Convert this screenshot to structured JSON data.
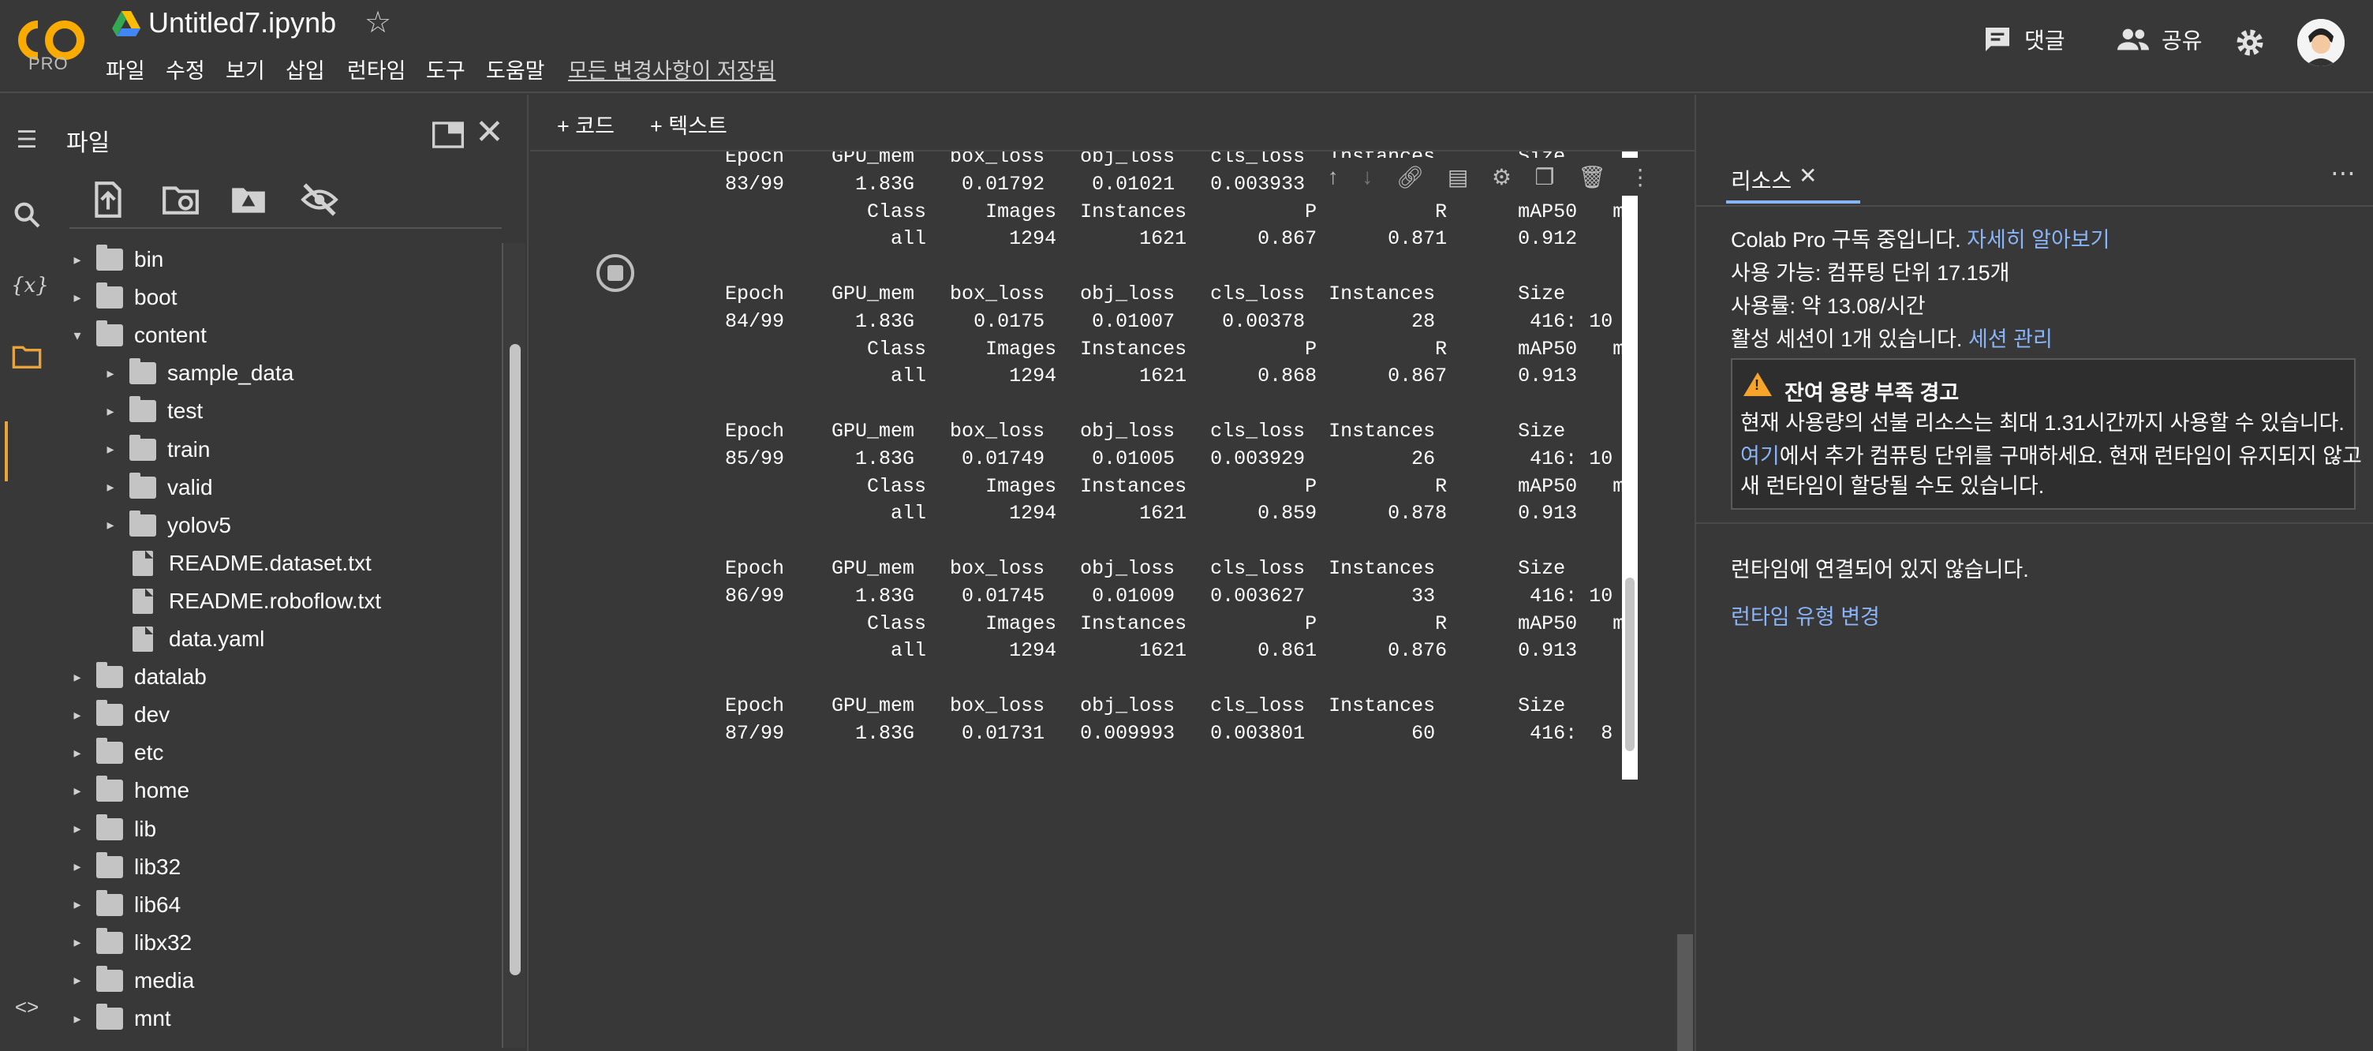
{
  "app": {
    "logo_text": "CO",
    "logo_tier": "PRO",
    "notebook_title": "Untitled7.ipynb",
    "menu": [
      "파일",
      "수정",
      "보기",
      "삽입",
      "런타임",
      "도구",
      "도움말"
    ],
    "saved_status": "모든 변경사항이 저장됨",
    "comments_label": "댓글",
    "share_label": "공유"
  },
  "notebook_toolbar": {
    "add_code": "+ 코드",
    "add_text": "+ 텍스트",
    "runtime_status": "바쁨"
  },
  "files_panel": {
    "title": "파일",
    "tree": [
      {
        "name": "bin",
        "type": "folder",
        "depth": 0,
        "expanded": false
      },
      {
        "name": "boot",
        "type": "folder",
        "depth": 0,
        "expanded": false
      },
      {
        "name": "content",
        "type": "folder",
        "depth": 0,
        "expanded": true
      },
      {
        "name": "sample_data",
        "type": "folder",
        "depth": 1,
        "expanded": false
      },
      {
        "name": "test",
        "type": "folder",
        "depth": 1,
        "expanded": false
      },
      {
        "name": "train",
        "type": "folder",
        "depth": 1,
        "expanded": false
      },
      {
        "name": "valid",
        "type": "folder",
        "depth": 1,
        "expanded": false
      },
      {
        "name": "yolov5",
        "type": "folder",
        "depth": 1,
        "expanded": false
      },
      {
        "name": "README.dataset.txt",
        "type": "file",
        "depth": 1
      },
      {
        "name": "README.roboflow.txt",
        "type": "file",
        "depth": 1
      },
      {
        "name": "data.yaml",
        "type": "file",
        "depth": 1
      },
      {
        "name": "datalab",
        "type": "folder",
        "depth": 0,
        "expanded": false
      },
      {
        "name": "dev",
        "type": "folder",
        "depth": 0,
        "expanded": false
      },
      {
        "name": "etc",
        "type": "folder",
        "depth": 0,
        "expanded": false
      },
      {
        "name": "home",
        "type": "folder",
        "depth": 0,
        "expanded": false
      },
      {
        "name": "lib",
        "type": "folder",
        "depth": 0,
        "expanded": false
      },
      {
        "name": "lib32",
        "type": "folder",
        "depth": 0,
        "expanded": false
      },
      {
        "name": "lib64",
        "type": "folder",
        "depth": 0,
        "expanded": false
      },
      {
        "name": "libx32",
        "type": "folder",
        "depth": 0,
        "expanded": false
      },
      {
        "name": "media",
        "type": "folder",
        "depth": 0,
        "expanded": false
      },
      {
        "name": "mnt",
        "type": "folder",
        "depth": 0,
        "expanded": false
      }
    ]
  },
  "output": {
    "text": "     Epoch    GPU_mem   box_loss   obj_loss   cls_loss  Instances       Size\n     83/99      1.83G    0.01792    0.01021   0.003933                          \n                 Class     Images  Instances          P          R      mAP50   m\n                   all       1294       1621      0.867      0.871      0.912\n\n     Epoch    GPU_mem   box_loss   obj_loss   cls_loss  Instances       Size\n     84/99      1.83G     0.0175    0.01007    0.00378         28        416: 10\n                 Class     Images  Instances          P          R      mAP50   m\n                   all       1294       1621      0.868      0.867      0.913\n\n     Epoch    GPU_mem   box_loss   obj_loss   cls_loss  Instances       Size\n     85/99      1.83G    0.01749    0.01005   0.003929         26        416: 10\n                 Class     Images  Instances          P          R      mAP50   m\n                   all       1294       1621      0.859      0.878      0.913\n\n     Epoch    GPU_mem   box_loss   obj_loss   cls_loss  Instances       Size\n     86/99      1.83G    0.01745    0.01009   0.003627         33        416: 10\n                 Class     Images  Instances          P          R      mAP50   m\n                   all       1294       1621      0.861      0.876      0.913\n\n     Epoch    GPU_mem   box_loss   obj_loss   cls_loss  Instances       Size\n     87/99      1.83G    0.01731   0.009993   0.003801         60        416:  8"
  },
  "resources": {
    "tab_label": "리소스",
    "line1_text": "Colab Pro 구독 중입니다.",
    "line1_link": "자세히 알아보기",
    "line2": "사용 가능: 컴퓨팅 단위 17.15개",
    "line3": "사용률: 약 13.08/시간",
    "line4_text": "활성 세션이 1개 있습니다.",
    "line4_link": "세션 관리",
    "warning": {
      "title": "잔여 용량 부족 경고",
      "line1": "현재 사용량의 선불 리소스는 최대 1.31시간까지 사용할 수 있습니다.",
      "line2_link": "여기",
      "line2_text": "에서 추가 컴퓨팅 단위를 구매하세요. 현재 런타임이 유지되지 않고",
      "line3": "새 런타임이 할당될 수도 있습니다."
    },
    "not_connected": "런타임에 연결되어 있지 않습니다.",
    "change_runtime": "런타임 유형 변경"
  },
  "colors": {
    "background": "#383838",
    "accent_link": "#8ab4f8",
    "logo_orange": "#f9ab00",
    "warning": "#f6a52a"
  }
}
